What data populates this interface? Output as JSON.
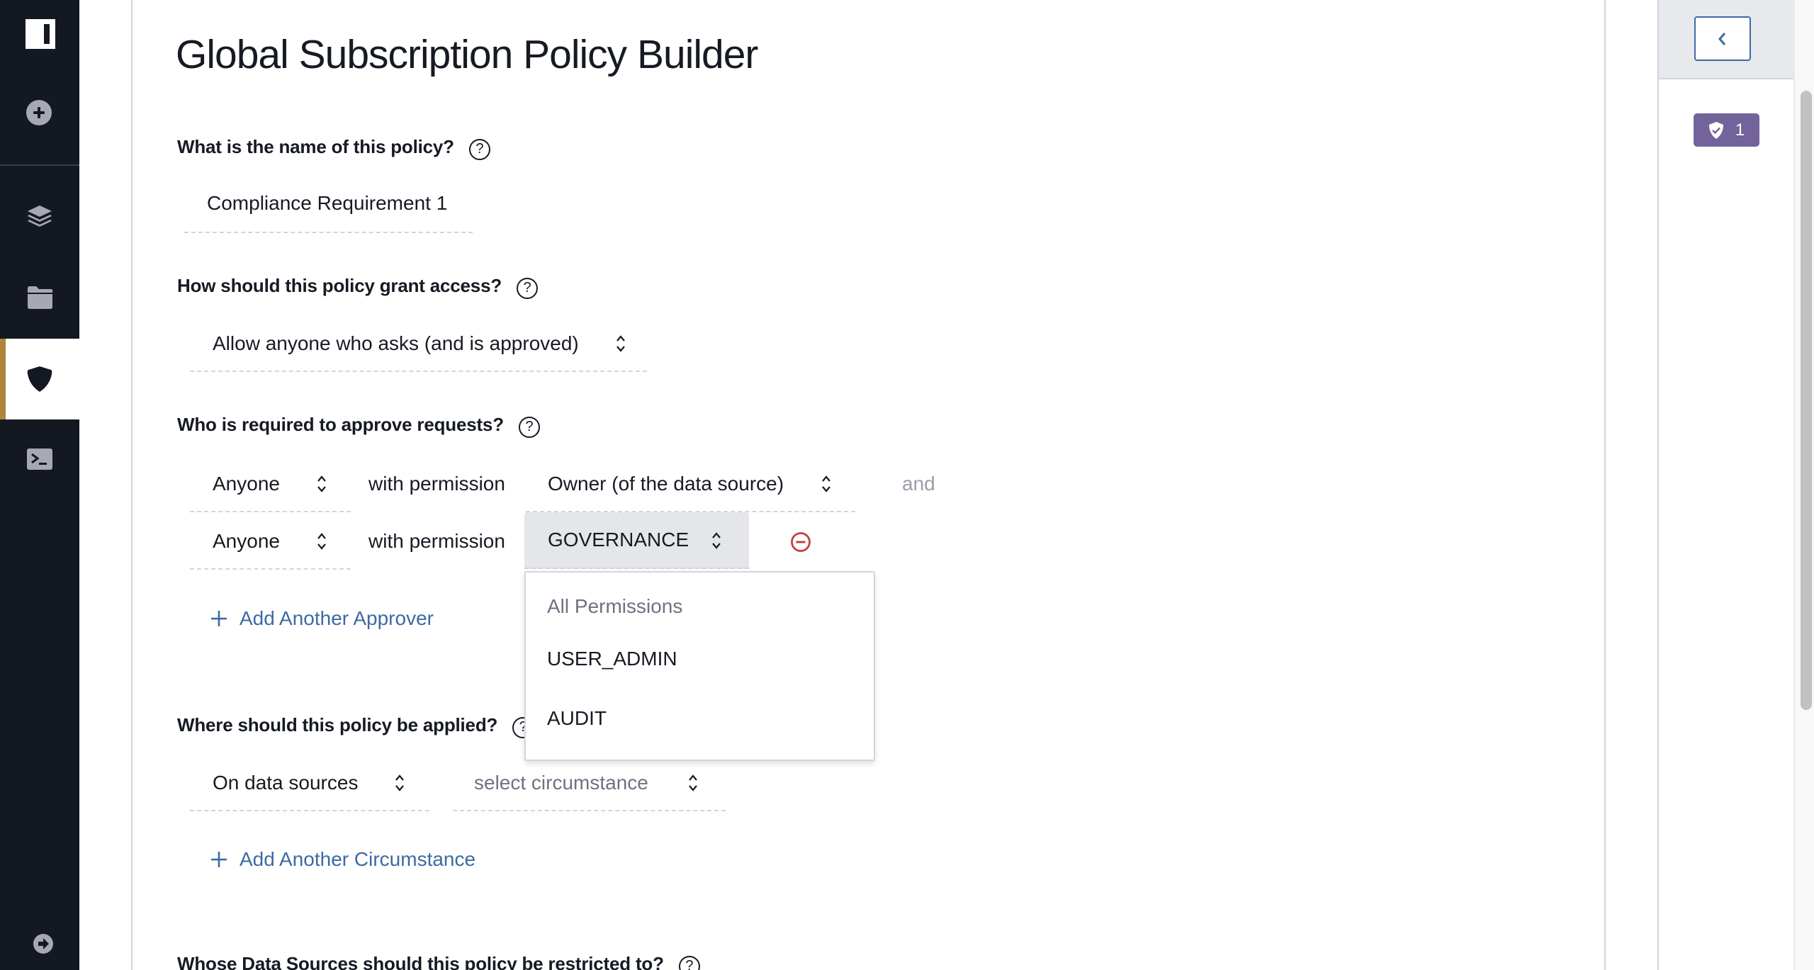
{
  "sidebar": {
    "items": [
      {
        "name": "add",
        "icon": "plus-circle-icon",
        "active": false
      },
      {
        "name": "data-sources",
        "icon": "layers-icon",
        "active": false
      },
      {
        "name": "projects",
        "icon": "folder-icon",
        "active": false
      },
      {
        "name": "policies",
        "icon": "shield-icon",
        "active": true
      },
      {
        "name": "query-editor",
        "icon": "terminal-icon",
        "active": false
      },
      {
        "name": "expand",
        "icon": "arrow-right-circle-icon",
        "active": false
      }
    ],
    "accent_color": "#b0843a"
  },
  "page": {
    "title": "Global Subscription Policy Builder"
  },
  "form": {
    "name_question": "What is the name of this policy?",
    "name_value": "Compliance Requirement 1",
    "access_question": "How should this policy grant access?",
    "access_value": "Allow anyone who asks (and is approved)",
    "approve_question": "Who is required to approve requests?",
    "approvers": [
      {
        "who": "Anyone",
        "connector": "with permission",
        "permission": "Owner (of the data source)",
        "suffix": "and"
      },
      {
        "who": "Anyone",
        "connector": "with permission",
        "permission": "GOVERNANCE"
      }
    ],
    "add_approver_label": "Add Another Approver",
    "apply_question": "Where should this policy be applied?",
    "apply_value": "On data sources",
    "circumstance_placeholder": "select circumstance",
    "add_circumstance_label": "Add Another Circumstance",
    "restrict_question": "Whose Data Sources should this policy be restricted to?",
    "help_glyph": "?"
  },
  "permission_dropdown": {
    "header": "All Permissions",
    "options": [
      "USER_ADMIN",
      "AUDIT"
    ]
  },
  "right_panel": {
    "collapse_icon": "chevron-left-icon",
    "badge_icon": "shield-check-icon",
    "badge_count": "1",
    "badge_color": "#72649a"
  },
  "colors": {
    "link": "#3d6aa3",
    "remove": "#c0433a",
    "sidebar_bg": "#141820"
  }
}
